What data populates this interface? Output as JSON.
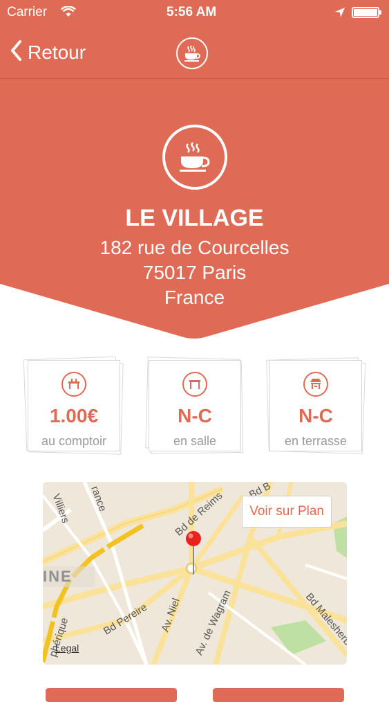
{
  "status_bar": {
    "carrier": "Carrier",
    "time": "5:56 AM"
  },
  "nav": {
    "back_label": "Retour"
  },
  "place": {
    "name": "LE VILLAGE",
    "address_line1": "182 rue de Courcelles",
    "address_line2": "75017 Paris",
    "address_line3": "France"
  },
  "prices": [
    {
      "value": "1.00€",
      "label": "au comptoir",
      "icon": "counter-icon"
    },
    {
      "value": "N-C",
      "label": "en salle",
      "icon": "table-icon"
    },
    {
      "value": "N-C",
      "label": "en terrasse",
      "icon": "terrace-icon"
    }
  ],
  "map": {
    "button_label": "Voir sur Plan",
    "legal": "Legal",
    "streets": [
      "Bd de Reims",
      "Bd B",
      "Villiers",
      "rance",
      "INE",
      "Bd Pereire",
      "Av. Niel",
      "Av. de Wagram",
      "Bd Malesherbes",
      "phérique"
    ]
  },
  "colors": {
    "accent": "#df6b56",
    "price": "#df6b56",
    "label": "#9a9a9a"
  }
}
